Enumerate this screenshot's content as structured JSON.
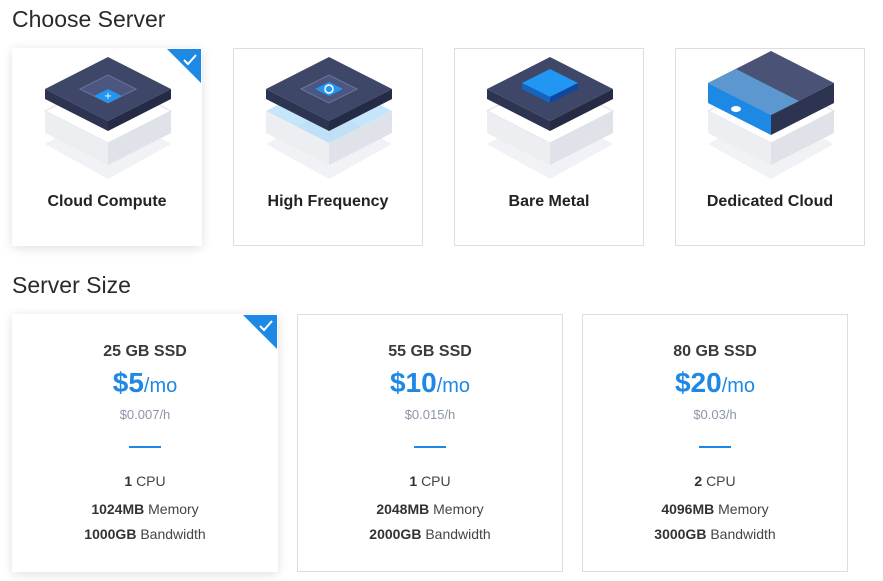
{
  "choose_server": {
    "title": "Choose Server",
    "cards": [
      {
        "label": "Cloud Compute",
        "selected": true
      },
      {
        "label": "High Frequency",
        "selected": false
      },
      {
        "label": "Bare Metal",
        "selected": false
      },
      {
        "label": "Dedicated Cloud",
        "selected": false
      }
    ]
  },
  "server_size": {
    "title": "Server Size",
    "plans": [
      {
        "storage": "25 GB SSD",
        "price": "$5",
        "per": "/mo",
        "hourly": "$0.007/h",
        "cpu_count": "1",
        "cpu_unit": "CPU",
        "memory": "1024MB",
        "memory_unit": "Memory",
        "bandwidth": "1000GB",
        "bandwidth_unit": "Bandwidth",
        "selected": true
      },
      {
        "storage": "55 GB SSD",
        "price": "$10",
        "per": "/mo",
        "hourly": "$0.015/h",
        "cpu_count": "1",
        "cpu_unit": "CPU",
        "memory": "2048MB",
        "memory_unit": "Memory",
        "bandwidth": "2000GB",
        "bandwidth_unit": "Bandwidth",
        "selected": false
      },
      {
        "storage": "80 GB SSD",
        "price": "$20",
        "per": "/mo",
        "hourly": "$0.03/h",
        "cpu_count": "2",
        "cpu_unit": "CPU",
        "memory": "4096MB",
        "memory_unit": "Memory",
        "bandwidth": "3000GB",
        "bandwidth_unit": "Bandwidth",
        "selected": false
      }
    ]
  },
  "colors": {
    "accent": "#1e88e5",
    "dark_navy": "#3a4266",
    "card_border": "#dcdde2"
  },
  "icons": [
    "checkmark-icon",
    "cloud-compute-illustration",
    "high-frequency-illustration",
    "bare-metal-illustration",
    "dedicated-cloud-illustration"
  ]
}
